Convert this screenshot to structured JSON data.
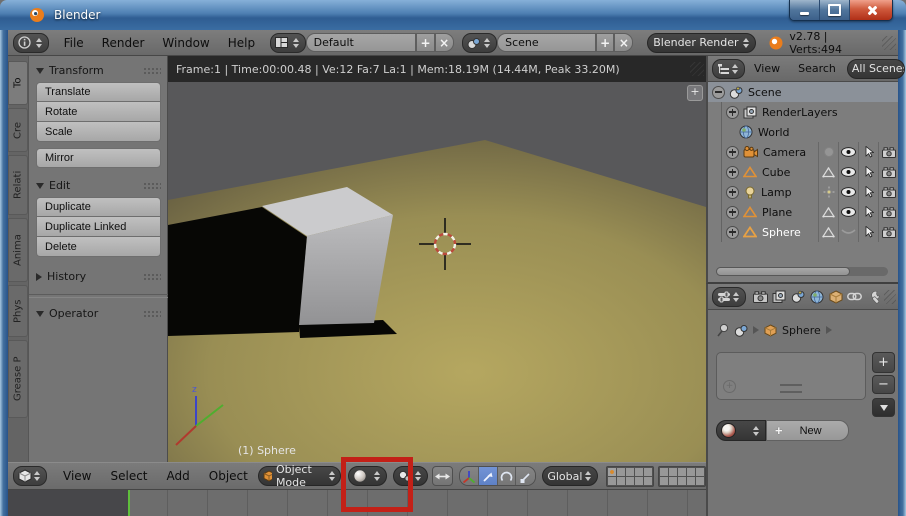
{
  "titlebar": {
    "title": "Blender"
  },
  "menubar": {
    "menus": [
      "File",
      "Render",
      "Window",
      "Help"
    ],
    "layout": {
      "value": "Default",
      "add": "+",
      "close": "×"
    },
    "scene": {
      "value": "Scene",
      "add": "+",
      "close": "×"
    },
    "engine": {
      "value": "Blender Render"
    },
    "status": "v2.78 | Verts:494"
  },
  "tool_shelf": {
    "tabs": [
      "To",
      "Cre",
      "Relati",
      "Anima",
      "Phys",
      "Grease P"
    ],
    "transform": {
      "title": "Transform",
      "buttons": [
        "Translate",
        "Rotate",
        "Scale"
      ],
      "mirror": "Mirror"
    },
    "edit": {
      "title": "Edit",
      "buttons": [
        "Duplicate",
        "Duplicate Linked",
        "Delete"
      ]
    },
    "history": {
      "title": "History"
    },
    "operator": {
      "title": "Operator"
    }
  },
  "viewport": {
    "stats": "Frame:1 | Time:00:00.48 | Ve:12 Fa:7 La:1 | Mem:18.19M (14.44M, Peak 33.20M)",
    "object_label": "(1) Sphere",
    "axis_z": "z",
    "region_toggle": "+",
    "colors": {
      "sky": "#58585a",
      "ground": "#b3a55e",
      "ground_edge": "#6a6243",
      "cube_top": "#cbcbcd",
      "cube_front": "#a9a9ab",
      "shadow": "#070705"
    }
  },
  "toolbar": {
    "menus": [
      "View",
      "Select",
      "Add",
      "Object"
    ],
    "mode": "Object Mode",
    "orientation": "Global"
  },
  "timeline": {
    "frame_marker_color": "#5fbf3c"
  },
  "outliner": {
    "menus": [
      "View",
      "Search"
    ],
    "scope": "All Scenes",
    "rows": [
      {
        "label": "Scene"
      },
      {
        "label": "RenderLayers"
      },
      {
        "label": "World"
      },
      {
        "label": "Camera"
      },
      {
        "label": "Cube"
      },
      {
        "label": "Lamp"
      },
      {
        "label": "Plane"
      },
      {
        "label": "Sphere"
      }
    ]
  },
  "properties": {
    "breadcrumb": {
      "object": "Sphere"
    },
    "material": {
      "add_slot": "+",
      "remove_slot": "−",
      "new": "New",
      "new_plus": "+"
    }
  },
  "annotation": {
    "color": "#c32017"
  }
}
